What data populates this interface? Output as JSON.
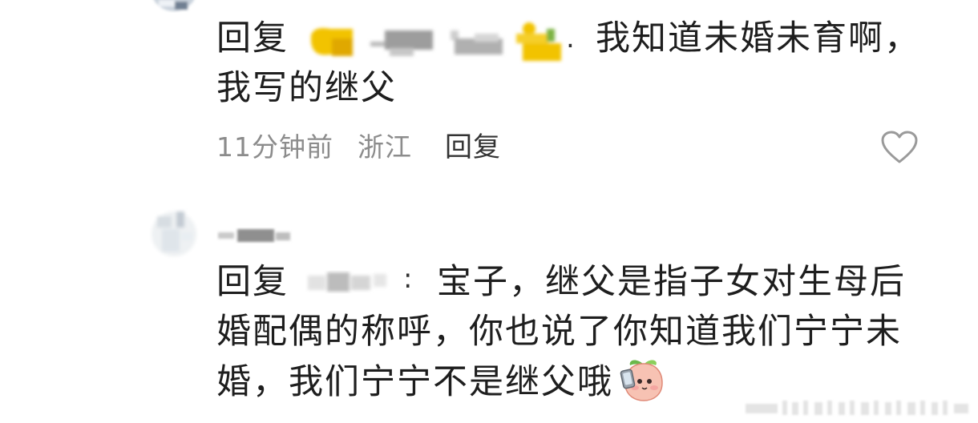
{
  "comments": [
    {
      "reply_prefix": "回复",
      "separator": ".",
      "text_lines": [
        "我知道未婚未育啊，",
        "我写的继父"
      ],
      "time": "11分钟前",
      "location": "浙江",
      "reply_label": "回复",
      "like_icon": "heart-outline-icon"
    },
    {
      "reply_prefix": "回复",
      "separator": ":",
      "text_lines": [
        "宝子，继父是指子女对生母后",
        "婚配偶的称呼，你也说了你知道我们宁宁未",
        "婚，我们宁宁不是继父哦"
      ],
      "sticker_icon": "peach-phone-sticker-icon"
    }
  ],
  "colors": {
    "text": "#1e1e1e",
    "meta_gray": "#8c8c8c",
    "reply_dark": "#333333",
    "icon_gray": "#9a9a9a",
    "emoji_yellow": "#f2c300"
  }
}
